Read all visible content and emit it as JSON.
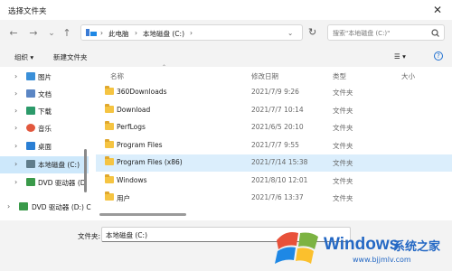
{
  "window": {
    "title": "选择文件夹",
    "close_glyph": "✕"
  },
  "nav": {
    "back": "←",
    "forward": "→",
    "up_menu": "⌄",
    "up": "↑",
    "breadcrumb": [
      "此电脑",
      "本地磁盘 (C:)"
    ],
    "refresh": "↻",
    "search_placeholder": "搜索\"本地磁盘 (C:)\""
  },
  "toolbar": {
    "organize": "组织 ▾",
    "new_folder": "新建文件夹",
    "view": "☰ ▾",
    "help": "?"
  },
  "sidebar": {
    "items": [
      {
        "label": "图片",
        "icon": "pictures-icon",
        "color": "#3a8fd8"
      },
      {
        "label": "文档",
        "icon": "documents-icon",
        "color": "#5b86c4"
      },
      {
        "label": "下载",
        "icon": "downloads-icon",
        "color": "#2c9a6a"
      },
      {
        "label": "音乐",
        "icon": "music-icon",
        "color": "#e2583e"
      },
      {
        "label": "桌面",
        "icon": "desktop-icon",
        "color": "#2a7fd4"
      },
      {
        "label": "本地磁盘 (C:)",
        "icon": "drive-icon",
        "color": "#607d8b"
      },
      {
        "label": "DVD 驱动器 (D",
        "icon": "dvd-icon",
        "color": "#3a9a4a"
      },
      {
        "label": "DVD 驱动器 (D:) C",
        "icon": "dvd-icon",
        "color": "#3a9a4a"
      }
    ]
  },
  "columns": {
    "name": "名称",
    "modified": "修改日期",
    "type": "类型",
    "size": "大小"
  },
  "files": [
    {
      "name": "360Downloads",
      "date": "2021/7/9 9:26",
      "type": "文件夹"
    },
    {
      "name": "Download",
      "date": "2021/7/7 10:14",
      "type": "文件夹"
    },
    {
      "name": "PerfLogs",
      "date": "2021/6/5 20:10",
      "type": "文件夹"
    },
    {
      "name": "Program Files",
      "date": "2021/7/7 9:55",
      "type": "文件夹"
    },
    {
      "name": "Program Files (x86)",
      "date": "2021/7/14 15:38",
      "type": "文件夹"
    },
    {
      "name": "Windows",
      "date": "2021/8/10 12:01",
      "type": "文件夹"
    },
    {
      "name": "用户",
      "date": "2021/7/6 13:37",
      "type": "文件夹"
    }
  ],
  "footer": {
    "folder_label": "文件夹:",
    "folder_value": "本地磁盘 (C:)"
  },
  "watermark": {
    "brand": "Windows",
    "cn": "系统之家",
    "url": "www.bjjmlv.com"
  }
}
